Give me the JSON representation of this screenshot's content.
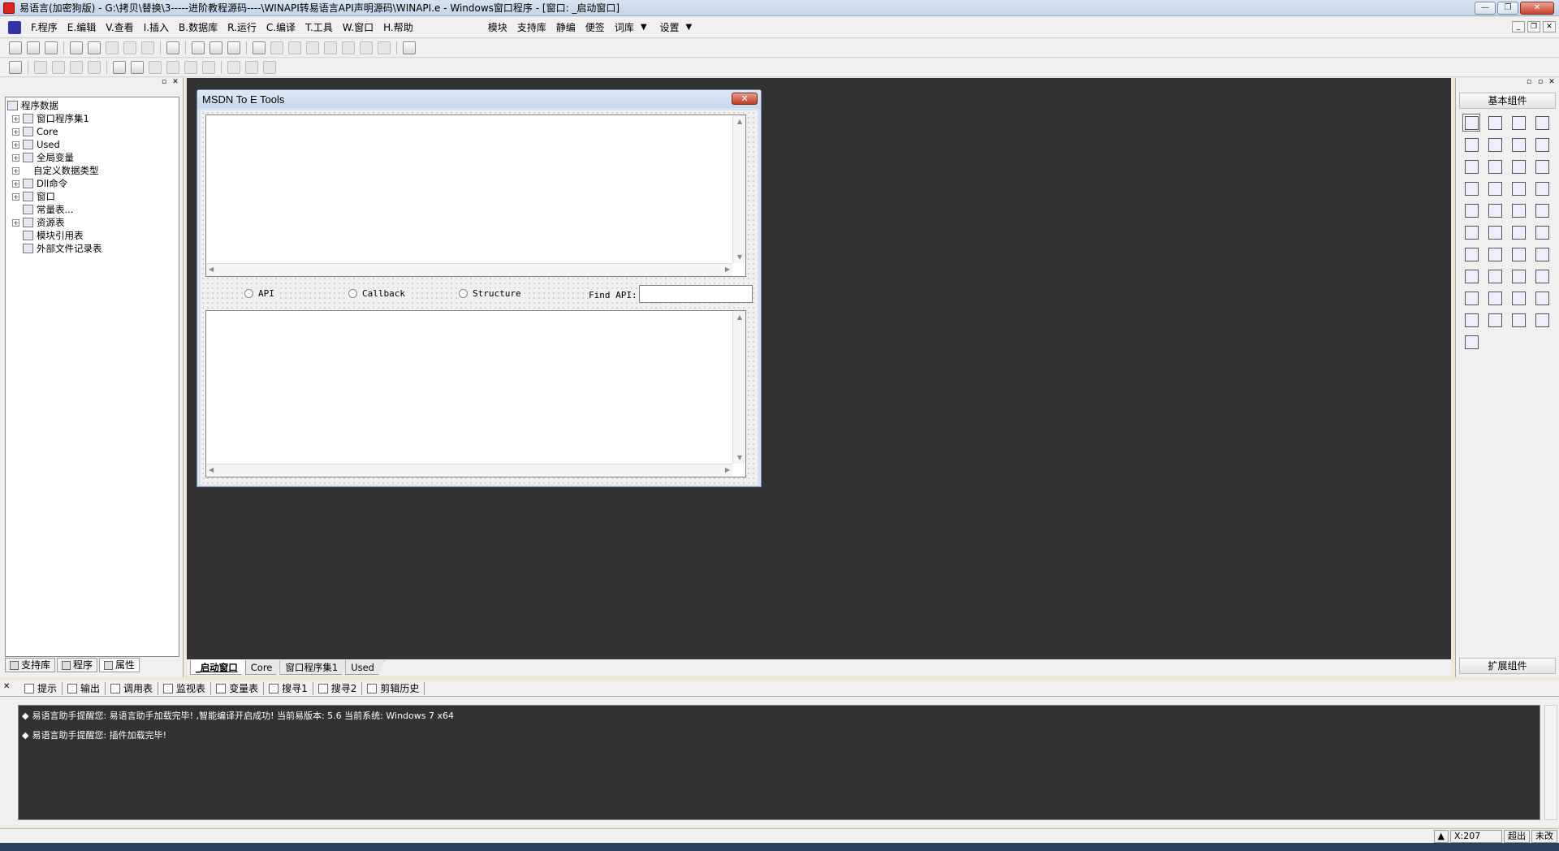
{
  "window": {
    "title": "易语言(加密狗版) - G:\\拷贝\\替换\\3-----进阶教程源码----\\WINAPI转易语言API声明源码\\WINAPI.e - Windows窗口程序 - [窗口: _启动窗口]"
  },
  "menu": {
    "items": [
      "F.程序",
      "E.编辑",
      "V.查看",
      "I.插入",
      "B.数据库",
      "R.运行",
      "C.编译",
      "T.工具",
      "W.窗口",
      "H.帮助"
    ],
    "extra": [
      "模块",
      "支持库",
      "静编",
      "便签",
      "词库",
      "设置"
    ]
  },
  "left_panel": {
    "tree": {
      "root": "程序数据",
      "items": [
        "窗口程序集1",
        "Core",
        "Used",
        "全局变量",
        "自定义数据类型",
        "Dll命令",
        "窗口",
        "常量表...",
        "资源表",
        "模块引用表",
        "外部文件记录表"
      ]
    },
    "tabs": [
      "支持库",
      "程序",
      "属性"
    ]
  },
  "form": {
    "title": "MSDN To E Tools",
    "radios": [
      "API",
      "Callback",
      "Structure"
    ],
    "find_label": "Find API:"
  },
  "designer_tabs": [
    "_启动窗口",
    "Core",
    "窗口程序集1",
    "Used"
  ],
  "right_panel": {
    "header": "基本组件",
    "footer": "扩展组件"
  },
  "output": {
    "tabs": [
      "提示",
      "输出",
      "调用表",
      "监视表",
      "变量表",
      "搜寻1",
      "搜寻2",
      "剪辑历史"
    ],
    "lines": [
      "易语言助手提醒您: 易语言助手加载完毕! ,智能编译开启成功! 当前易版本: 5.6 当前系统: Windows 7 x64",
      "易语言助手提醒您: 插件加载完毕!"
    ]
  },
  "status": {
    "coord": "X:207",
    "overwrite": "超出",
    "modified": "未改"
  }
}
